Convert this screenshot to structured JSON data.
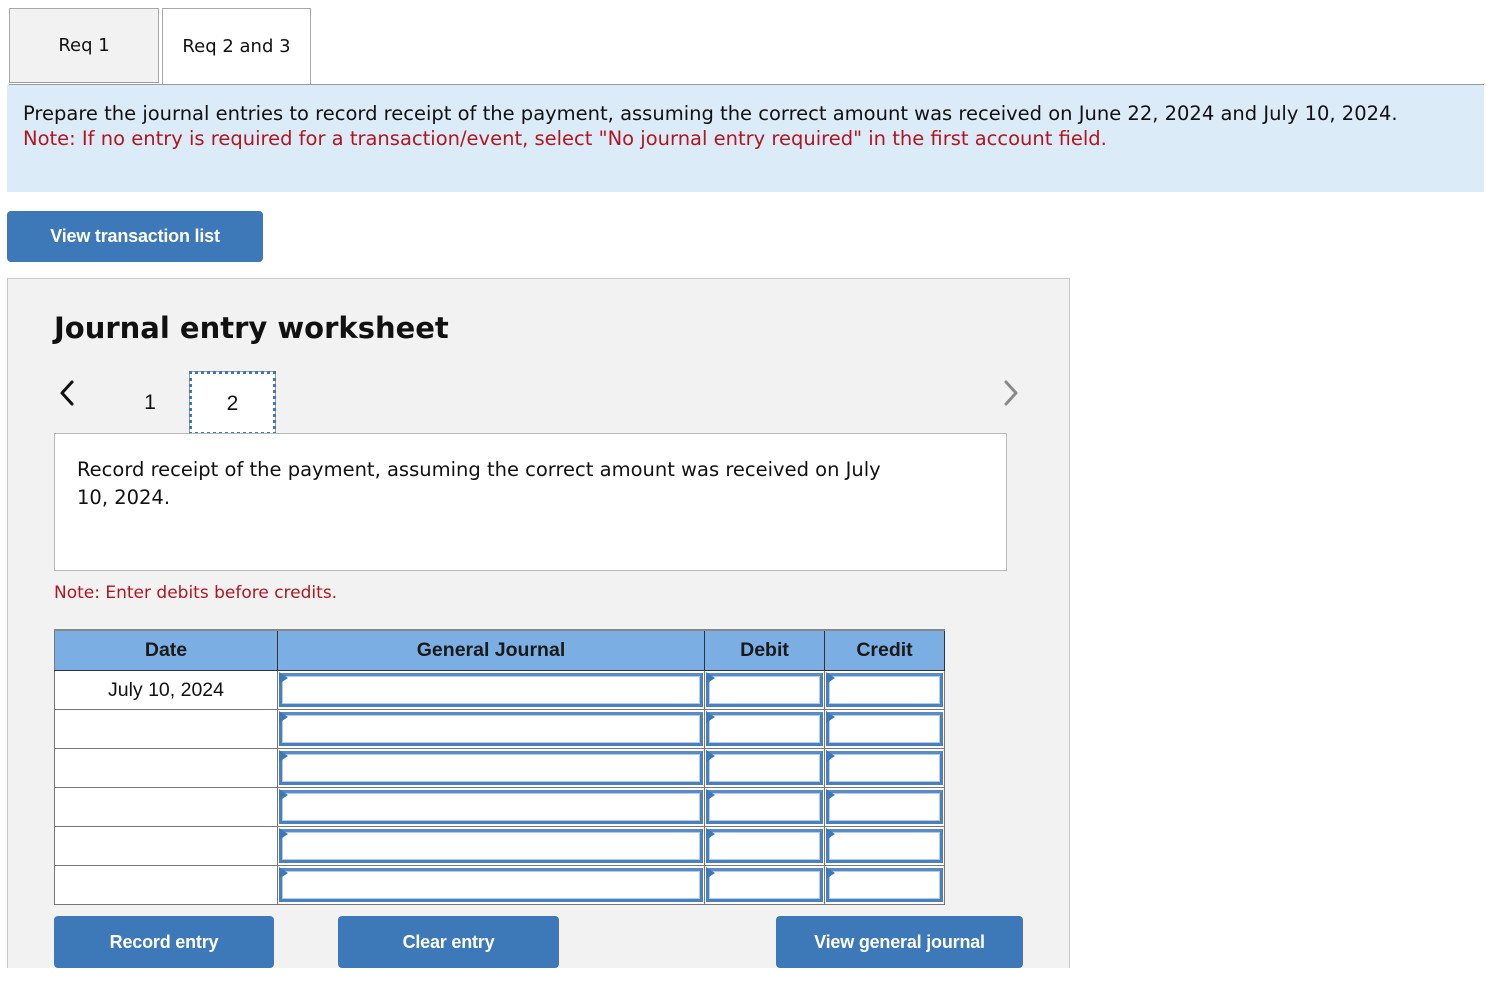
{
  "tabs": [
    {
      "label": "Req 1",
      "active": false
    },
    {
      "label": "Req 2 and 3",
      "active": true
    }
  ],
  "instructions": {
    "text": "Prepare the journal entries to record receipt of the payment, assuming the correct amount was received on June 22, 2024 and July 10, 2024.",
    "note": "Note: If no entry is required for a transaction/event, select \"No journal entry required\" in the first account field."
  },
  "buttons": {
    "view_transaction_list": "View transaction list",
    "record_entry": "Record entry",
    "clear_entry": "Clear entry",
    "view_general_journal": "View general journal"
  },
  "worksheet": {
    "title": "Journal entry worksheet",
    "pagination": {
      "prev_icon": "chevron-left-icon",
      "next_icon": "chevron-right-icon",
      "pages": [
        "1",
        "2"
      ],
      "current_page": "2"
    },
    "description": "Record receipt of the payment, assuming the correct amount was received on July 10, 2024.",
    "note": "Note: Enter debits before credits.",
    "table": {
      "headers": [
        "Date",
        "General Journal",
        "Debit",
        "Credit"
      ],
      "rows": [
        {
          "date": "July 10, 2024",
          "account": "",
          "debit": "",
          "credit": ""
        },
        {
          "date": "",
          "account": "",
          "debit": "",
          "credit": ""
        },
        {
          "date": "",
          "account": "",
          "debit": "",
          "credit": ""
        },
        {
          "date": "",
          "account": "",
          "debit": "",
          "credit": ""
        },
        {
          "date": "",
          "account": "",
          "debit": "",
          "credit": ""
        },
        {
          "date": "",
          "account": "",
          "debit": "",
          "credit": ""
        }
      ]
    }
  },
  "colors": {
    "accent": "#3d78b8",
    "table_header": "#7baee2",
    "banner_bg": "#dcebf8",
    "note_red": "#b0161f",
    "panel_bg": "#f2f2f2"
  }
}
